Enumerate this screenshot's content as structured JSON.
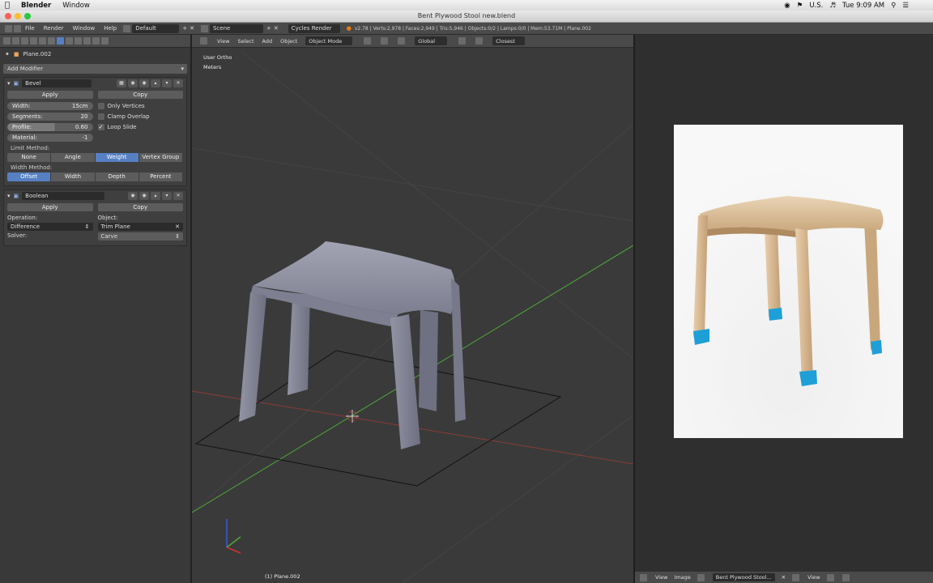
{
  "menubar": {
    "app_name": "Blender",
    "items": [
      "Window"
    ],
    "locale": "U.S.",
    "clock": "Tue 9:09 AM"
  },
  "window": {
    "title": "Bent Plywood Stool new.blend"
  },
  "infobar": {
    "menus": [
      "File",
      "Render",
      "Window",
      "Help"
    ],
    "screen_layout": "Default",
    "scene": "Scene",
    "render_engine": "Cycles Render",
    "stats": "v2.78 | Verts:2,978 | Faces:2,949 | Tris:5,946 | Objects:0/2 | Lamps:0/0 | Mem:53.71M | Plane.002"
  },
  "properties": {
    "object_path": "Plane.002",
    "add_modifier_label": "Add Modifier",
    "bevel": {
      "name": "Bevel",
      "apply_label": "Apply",
      "copy_label": "Copy",
      "width_label": "Width:",
      "width_value": "15cm",
      "segments_label": "Segments:",
      "segments_value": "20",
      "profile_label": "Profile:",
      "profile_value": "0.60",
      "material_label": "Material:",
      "material_value": "-1",
      "only_vertices": "Only Vertices",
      "clamp_overlap": "Clamp Overlap",
      "loop_slide": "Loop Slide",
      "limit_method_label": "Limit Method:",
      "limit_methods": [
        "None",
        "Angle",
        "Weight",
        "Vertex Group"
      ],
      "limit_selected": 2,
      "width_method_label": "Width Method:",
      "width_methods": [
        "Offset",
        "Width",
        "Depth",
        "Percent"
      ],
      "width_selected": 0
    },
    "boolean": {
      "name": "Boolean",
      "apply_label": "Apply",
      "copy_label": "Copy",
      "operation_label": "Operation:",
      "operation_value": "Difference",
      "object_label": "Object:",
      "object_value": "Trim Plane",
      "solver_label": "Solver:",
      "solver_value": "Carve"
    }
  },
  "viewport": {
    "header_items": [
      "View",
      "Select",
      "Add",
      "Object",
      "Object Mode",
      "Global",
      "Closest"
    ],
    "view_name": "User Ortho",
    "units": "Meters",
    "footer_object": "(1) Plane.002",
    "colors": {
      "background": "#3a3a3a",
      "mesh": "#8a8b9c",
      "x_axis": "#b03838",
      "y_axis": "#4fa83a"
    }
  },
  "image_editor": {
    "footer_items": [
      "View",
      "Image"
    ],
    "image_name": "Bent Plywood Stool...",
    "footer_view": "View",
    "colors": {
      "wood": "#e3c8a4",
      "feet": "#1e9fd8"
    }
  }
}
